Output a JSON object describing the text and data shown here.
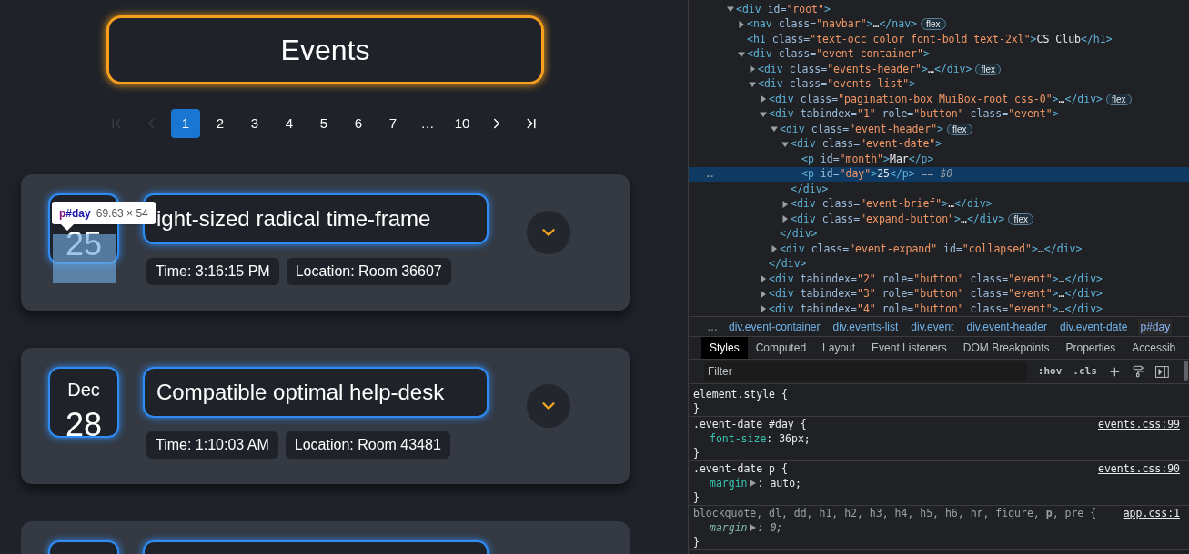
{
  "page": {
    "heading": "Events",
    "pagination": [
      {
        "kind": "first",
        "disabled": true
      },
      {
        "kind": "prev",
        "disabled": true
      },
      {
        "kind": "page",
        "label": "1",
        "selected": true
      },
      {
        "kind": "page",
        "label": "2",
        "selected": false
      },
      {
        "kind": "page",
        "label": "3",
        "selected": false
      },
      {
        "kind": "page",
        "label": "4",
        "selected": false
      },
      {
        "kind": "page",
        "label": "5",
        "selected": false
      },
      {
        "kind": "page",
        "label": "6",
        "selected": false
      },
      {
        "kind": "page",
        "label": "7",
        "selected": false
      },
      {
        "kind": "ellipsis",
        "label": "…"
      },
      {
        "kind": "page",
        "label": "10",
        "selected": false
      },
      {
        "kind": "next",
        "disabled": false
      },
      {
        "kind": "last",
        "disabled": false
      }
    ],
    "events": [
      {
        "kind": "full",
        "day": "25",
        "title": "ight-sized radical time-frame",
        "time": "Time: 3:16:15 PM",
        "location": "Location: Room 36607",
        "expanded": false,
        "inspector": {
          "tag": "p",
          "id": "#day",
          "size": "69.63 × 54"
        }
      },
      {
        "kind": "full",
        "month": "Dec",
        "day": "28",
        "title": "Compatible optimal help-desk",
        "time": "Time: 1:10:03 AM",
        "location": "Location: Room 43481",
        "expanded": false
      },
      {
        "kind": "cut"
      }
    ]
  },
  "devtools": {
    "dom_tree": {
      "gutter_marker": "…",
      "nodes": [
        {
          "kind": "branch",
          "expanded": true,
          "selected": false,
          "tokens": [
            {
              "tag": "<div"
            },
            {
              "attr": " id="
            },
            {
              "value": "\"root\""
            },
            {
              "tag": ">"
            }
          ],
          "children": [
            {
              "kind": "branch",
              "expanded": false,
              "selected": false,
              "badge": "flex",
              "tokens": [
                {
                  "tag": "<nav"
                },
                {
                  "attr": " class="
                },
                {
                  "value": "\"navbar\""
                },
                {
                  "tag": ">"
                },
                {
                  "text": "…"
                },
                {
                  "tag": "</nav>"
                }
              ]
            },
            {
              "kind": "leaf",
              "selected": false,
              "tokens": [
                {
                  "tag": "<h1"
                },
                {
                  "attr": " class="
                },
                {
                  "value": "\"text-occ_color font-bold text-2xl\""
                },
                {
                  "tag": ">"
                },
                {
                  "text": "CS Club"
                },
                {
                  "tag": "</h1>"
                }
              ]
            },
            {
              "kind": "branch",
              "expanded": true,
              "selected": false,
              "tokens": [
                {
                  "tag": "<div"
                },
                {
                  "attr": " class="
                },
                {
                  "value": "\"event-container\""
                },
                {
                  "tag": ">"
                }
              ],
              "children": [
                {
                  "kind": "branch",
                  "expanded": false,
                  "selected": false,
                  "badge": "flex",
                  "tokens": [
                    {
                      "tag": "<div"
                    },
                    {
                      "attr": " class="
                    },
                    {
                      "value": "\"events-header\""
                    },
                    {
                      "tag": ">"
                    },
                    {
                      "text": "…"
                    },
                    {
                      "tag": "</div>"
                    }
                  ]
                },
                {
                  "kind": "branch",
                  "expanded": true,
                  "selected": false,
                  "tokens": [
                    {
                      "tag": "<div"
                    },
                    {
                      "attr": " class="
                    },
                    {
                      "value": "\"events-list\""
                    },
                    {
                      "tag": ">"
                    }
                  ],
                  "children": [
                    {
                      "kind": "branch",
                      "expanded": false,
                      "selected": false,
                      "badge": "flex",
                      "tokens": [
                        {
                          "tag": "<div"
                        },
                        {
                          "attr": " class="
                        },
                        {
                          "value": "\"pagination-box MuiBox-root css-0\""
                        },
                        {
                          "tag": ">"
                        },
                        {
                          "text": "…"
                        },
                        {
                          "tag": "</div>"
                        }
                      ]
                    },
                    {
                      "kind": "branch",
                      "expanded": true,
                      "selected": false,
                      "tokens": [
                        {
                          "tag": "<div"
                        },
                        {
                          "attr": " tabindex="
                        },
                        {
                          "value": "\"1\""
                        },
                        {
                          "attr": " role="
                        },
                        {
                          "value": "\"button\""
                        },
                        {
                          "attr": " class="
                        },
                        {
                          "value": "\"event\""
                        },
                        {
                          "tag": ">"
                        }
                      ],
                      "closing": [
                        {
                          "tag": "</div>"
                        }
                      ],
                      "children": [
                        {
                          "kind": "branch",
                          "expanded": true,
                          "selected": false,
                          "badge": "flex",
                          "tokens": [
                            {
                              "tag": "<div"
                            },
                            {
                              "attr": " class="
                            },
                            {
                              "value": "\"event-header\""
                            },
                            {
                              "tag": ">"
                            }
                          ],
                          "closing": [
                            {
                              "tag": "</div>"
                            }
                          ],
                          "children": [
                            {
                              "kind": "branch",
                              "expanded": true,
                              "selected": false,
                              "tokens": [
                                {
                                  "tag": "<div"
                                },
                                {
                                  "attr": " class="
                                },
                                {
                                  "value": "\"event-date\""
                                },
                                {
                                  "tag": ">"
                                }
                              ],
                              "closing": [
                                {
                                  "tag": "</div>"
                                }
                              ],
                              "children": [
                                {
                                  "kind": "leaf",
                                  "selected": false,
                                  "tokens": [
                                    {
                                      "tag": "<p"
                                    },
                                    {
                                      "attr": " id="
                                    },
                                    {
                                      "value": "\"month\""
                                    },
                                    {
                                      "tag": ">"
                                    },
                                    {
                                      "text": "Mar"
                                    },
                                    {
                                      "tag": "</p>"
                                    }
                                  ]
                                },
                                {
                                  "kind": "leaf",
                                  "selected": true,
                                  "tokens": [
                                    {
                                      "tag": "<p"
                                    },
                                    {
                                      "attr": " id="
                                    },
                                    {
                                      "value": "\"day\""
                                    },
                                    {
                                      "tag": ">"
                                    },
                                    {
                                      "text": "25"
                                    },
                                    {
                                      "tag": "</p>"
                                    },
                                    {
                                      "dim": " == $0"
                                    }
                                  ]
                                }
                              ]
                            },
                            {
                              "kind": "branch",
                              "expanded": false,
                              "selected": false,
                              "tokens": [
                                {
                                  "tag": "<div"
                                },
                                {
                                  "attr": " class="
                                },
                                {
                                  "value": "\"event-brief\""
                                },
                                {
                                  "tag": ">"
                                },
                                {
                                  "text": "…"
                                },
                                {
                                  "tag": "</div>"
                                }
                              ]
                            },
                            {
                              "kind": "branch",
                              "expanded": false,
                              "selected": false,
                              "badge": "flex",
                              "tokens": [
                                {
                                  "tag": "<div"
                                },
                                {
                                  "attr": " class="
                                },
                                {
                                  "value": "\"expand-button\""
                                },
                                {
                                  "tag": ">"
                                },
                                {
                                  "text": "…"
                                },
                                {
                                  "tag": "</div>"
                                }
                              ]
                            }
                          ]
                        },
                        {
                          "kind": "branch",
                          "expanded": false,
                          "selected": false,
                          "tokens": [
                            {
                              "tag": "<div"
                            },
                            {
                              "attr": " class="
                            },
                            {
                              "value": "\"event-expand\""
                            },
                            {
                              "attr": " id="
                            },
                            {
                              "value": "\"collapsed\""
                            },
                            {
                              "tag": ">"
                            },
                            {
                              "text": "…"
                            },
                            {
                              "tag": "</div>"
                            }
                          ]
                        }
                      ]
                    },
                    {
                      "kind": "branch",
                      "expanded": false,
                      "selected": false,
                      "tokens": [
                        {
                          "tag": "<div"
                        },
                        {
                          "attr": " tabindex="
                        },
                        {
                          "value": "\"2\""
                        },
                        {
                          "attr": " role="
                        },
                        {
                          "value": "\"button\""
                        },
                        {
                          "attr": " class="
                        },
                        {
                          "value": "\"event\""
                        },
                        {
                          "tag": ">"
                        },
                        {
                          "text": "…"
                        },
                        {
                          "tag": "</div>"
                        }
                      ]
                    },
                    {
                      "kind": "branch",
                      "expanded": false,
                      "selected": false,
                      "tokens": [
                        {
                          "tag": "<div"
                        },
                        {
                          "attr": " tabindex="
                        },
                        {
                          "value": "\"3\""
                        },
                        {
                          "attr": " role="
                        },
                        {
                          "value": "\"button\""
                        },
                        {
                          "attr": " class="
                        },
                        {
                          "value": "\"event\""
                        },
                        {
                          "tag": ">"
                        },
                        {
                          "text": "…"
                        },
                        {
                          "tag": "</div>"
                        }
                      ]
                    },
                    {
                      "kind": "branch",
                      "expanded": false,
                      "selected": false,
                      "tokens": [
                        {
                          "tag": "<div"
                        },
                        {
                          "attr": " tabindex="
                        },
                        {
                          "value": "\"4\""
                        },
                        {
                          "attr": " role="
                        },
                        {
                          "value": "\"button\""
                        },
                        {
                          "attr": " class="
                        },
                        {
                          "value": "\"event\""
                        },
                        {
                          "tag": ">"
                        },
                        {
                          "text": "…"
                        },
                        {
                          "tag": "</div>"
                        }
                      ]
                    }
                  ]
                }
              ]
            }
          ]
        }
      ]
    },
    "breadcrumbs": {
      "overflow": "…",
      "items": [
        {
          "label": "div.event-container",
          "selected": false
        },
        {
          "label": "div.events-list",
          "selected": false
        },
        {
          "label": "div.event",
          "selected": false
        },
        {
          "label": "div.event-header",
          "selected": false
        },
        {
          "label": "div.event-date",
          "selected": false
        },
        {
          "label": "p#day",
          "selected": true
        }
      ]
    },
    "tabs": [
      {
        "label": "Styles",
        "selected": true
      },
      {
        "label": "Computed",
        "selected": false
      },
      {
        "label": "Layout",
        "selected": false
      },
      {
        "label": "Event Listeners",
        "selected": false
      },
      {
        "label": "DOM Breakpoints",
        "selected": false
      },
      {
        "label": "Properties",
        "selected": false
      },
      {
        "label": "Accessib",
        "selected": false
      }
    ],
    "filter": {
      "placeholder": "Filter",
      "buttons": [
        ":hov",
        ".cls"
      ]
    },
    "rules": [
      {
        "kind": "inline",
        "selector": "element.style {",
        "close": "}"
      },
      {
        "kind": "matched",
        "selector": ".event-date #day {",
        "source": "events.css:99",
        "close": "}",
        "properties": [
          {
            "name": "font-size",
            "value": ": 36px;",
            "expandable": false,
            "overridden": false
          }
        ]
      },
      {
        "kind": "matched",
        "selector": ".event-date p {",
        "source": "events.css:90",
        "close": "}",
        "properties": [
          {
            "name": "margin",
            "value": ": auto;",
            "expandable": true,
            "overridden": false
          }
        ]
      },
      {
        "kind": "inherited",
        "selector": "blockquote, dl, dd, h1, h2, h3, h4, h5, h6, hr, figure, **p**, pre {",
        "source": "app.css:1",
        "close": "}",
        "properties": [
          {
            "name": "margin",
            "value": ": 0;",
            "expandable": true,
            "overridden": true
          }
        ]
      }
    ]
  }
}
